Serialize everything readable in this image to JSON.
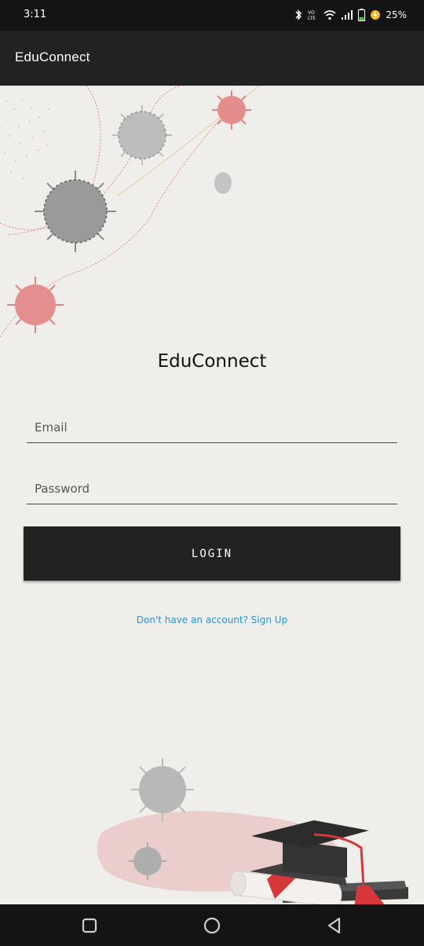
{
  "status_bar": {
    "time": "3:11",
    "battery_percent": "25%",
    "icons": [
      "bluetooth-icon",
      "volte-icon",
      "wifi-icon",
      "signal-icon",
      "battery-icon",
      "charging-icon"
    ]
  },
  "app_bar": {
    "title": "EduConnect"
  },
  "login": {
    "brand_title": "EduConnect",
    "email_placeholder": "Email",
    "password_placeholder": "Password",
    "login_button_label": "LOGIN",
    "signup_prompt": "Don't have an account? Sign Up"
  },
  "nav_bar": {
    "icons": [
      "recent-apps-icon",
      "home-icon",
      "back-icon"
    ]
  },
  "colors": {
    "app_bar_bg": "#222222",
    "status_bar_bg": "#141414",
    "page_bg": "#efeeea",
    "button_bg": "#222222",
    "link_color": "#2b8fd0"
  }
}
